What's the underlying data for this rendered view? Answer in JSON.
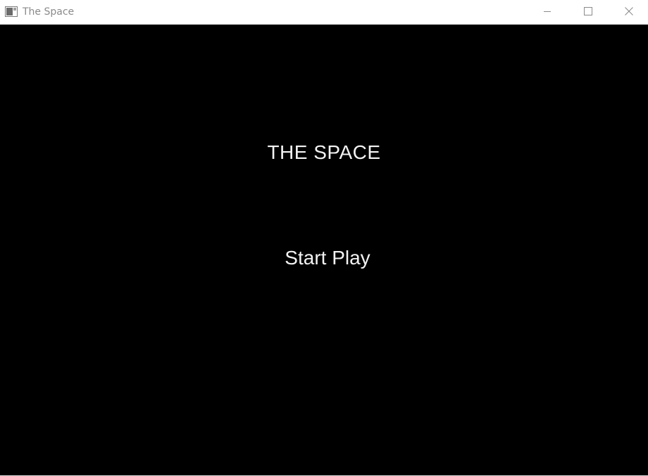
{
  "window": {
    "title": "The Space",
    "icons": {
      "app": "app-window-icon",
      "minimize": "minimize-icon",
      "maximize": "maximize-icon",
      "close": "close-icon"
    }
  },
  "game": {
    "title": "THE SPACE",
    "start_label": "Start Play",
    "background_color": "#000000",
    "text_color": "#f2f2f2"
  }
}
